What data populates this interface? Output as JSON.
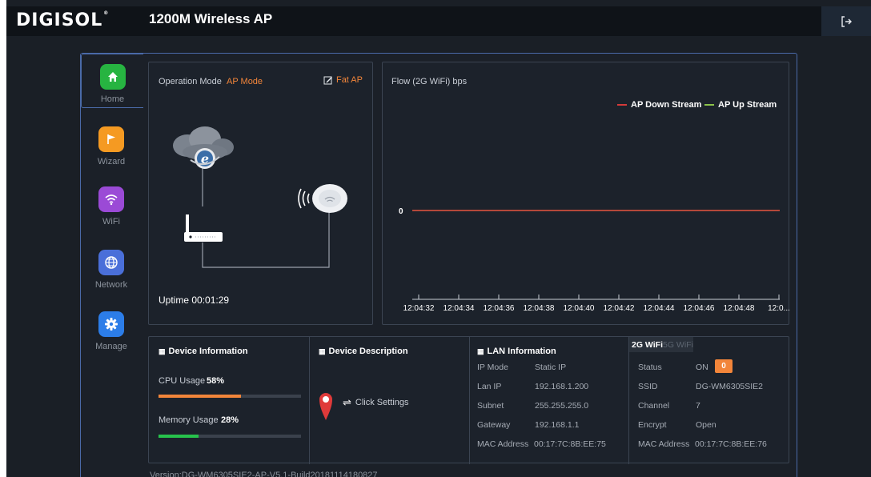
{
  "header": {
    "brand": "DIGISOL",
    "brand_mark": "®",
    "product_title": "1200M Wireless AP",
    "logout_icon": "logout-icon"
  },
  "sidebar": {
    "items": [
      {
        "label": "Home",
        "icon": "home-icon",
        "color": "#27b441",
        "active": true
      },
      {
        "label": "Wizard",
        "icon": "flag-icon",
        "color": "#f59a22",
        "active": false
      },
      {
        "label": "WiFi",
        "icon": "wifi-icon",
        "color": "#9b4ad6",
        "active": false
      },
      {
        "label": "Network",
        "icon": "globe-icon",
        "color": "#4a6fd9",
        "active": false
      },
      {
        "label": "Manage",
        "icon": "gear-icon",
        "color": "#2c7de8",
        "active": false
      }
    ]
  },
  "mode_panel": {
    "label": "Operation Mode",
    "value": "AP Mode",
    "fat_ap": "Fat AP",
    "uptime_label": "Uptime",
    "uptime_value": "00:01:29"
  },
  "flow": {
    "title": "Flow (2G WiFi) bps"
  },
  "chart_data": {
    "type": "line",
    "x": [
      "12:04:32",
      "12:04:34",
      "12:04:36",
      "12:04:38",
      "12:04:40",
      "12:04:42",
      "12:04:44",
      "12:04:46",
      "12:04:48",
      "12:0..."
    ],
    "series": [
      {
        "name": "AP Down Stream",
        "color": "#d43a3a",
        "values": [
          0,
          0,
          0,
          0,
          0,
          0,
          0,
          0,
          0,
          0
        ]
      },
      {
        "name": "AP Up Stream",
        "color": "#8bc34a",
        "values": [
          0,
          0,
          0,
          0,
          0,
          0,
          0,
          0,
          0,
          0
        ]
      }
    ],
    "y_ticks": [
      "0"
    ],
    "legend_position": "top-right",
    "grid": false
  },
  "device_info": {
    "title": "Device Information",
    "cpu_label": "CPU Usage",
    "cpu_value": "58%",
    "cpu_fraction": 0.58,
    "cpu_color": "#f2853a",
    "memory_label": "Memory Usage",
    "memory_value": "28%",
    "memory_fraction": 0.28,
    "memory_color": "#27c24c"
  },
  "device_desc": {
    "title": "Device Description",
    "click_settings": "Click Settings"
  },
  "lan": {
    "title": "LAN Information",
    "rows": [
      {
        "label": "IP Mode",
        "value": "Static IP"
      },
      {
        "label": "Lan IP",
        "value": "192.168.1.200"
      },
      {
        "label": "Subnet",
        "value": "255.255.255.0"
      },
      {
        "label": "Gateway",
        "value": "192.168.1.1"
      },
      {
        "label": "MAC Address",
        "value": "00:17:7C:8B:EE:75"
      }
    ]
  },
  "wifi": {
    "tab_2g": "2G WiFi",
    "tab_5g": "5G WiFi",
    "status_label": "Status",
    "status_value": "ON",
    "status_count": "0",
    "rows": [
      {
        "label": "SSID",
        "value": "DG-WM6305SIE2"
      },
      {
        "label": "Channel",
        "value": "7"
      },
      {
        "label": "Encrypt",
        "value": "Open"
      },
      {
        "label": "MAC Address",
        "value": "00:17:7C:8B:EE:76"
      }
    ]
  },
  "footer": {
    "version": "Version:DG-WM6305SIE2-AP-V5.1-Build20181114180827"
  }
}
